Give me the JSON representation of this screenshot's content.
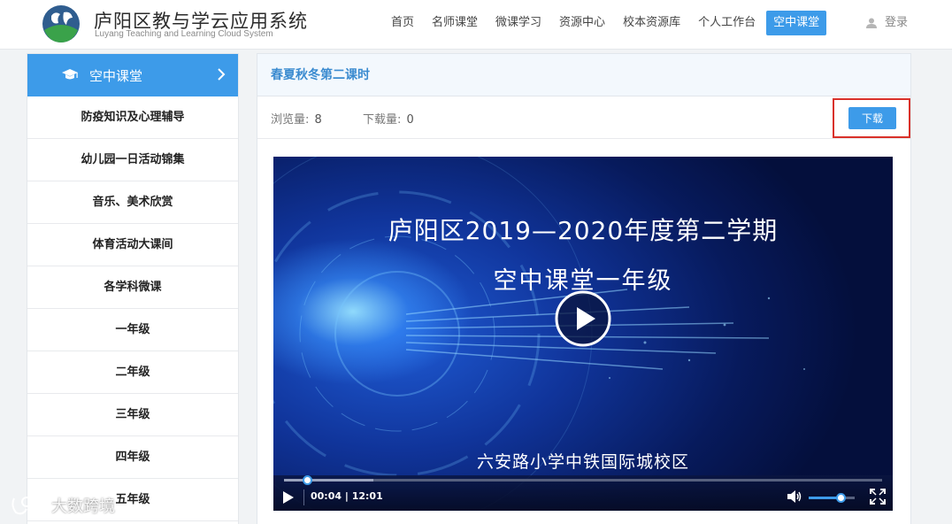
{
  "brand": {
    "title": "庐阳区教与学云应用系统",
    "subtitle": "Luyang Teaching and Learning Cloud System"
  },
  "nav": {
    "items": [
      {
        "label": "首页"
      },
      {
        "label": "名师课堂"
      },
      {
        "label": "微课学习"
      },
      {
        "label": "资源中心"
      },
      {
        "label": "校本资源库"
      },
      {
        "label": "个人工作台"
      },
      {
        "label": "空中课堂",
        "active": true
      }
    ],
    "login_label": "登录"
  },
  "sidebar": {
    "header": "空中课堂",
    "items": [
      {
        "label": "防疫知识及心理辅导"
      },
      {
        "label": "幼儿园一日活动锦集"
      },
      {
        "label": "音乐、美术欣赏"
      },
      {
        "label": "体育活动大课间"
      },
      {
        "label": "各学科微课"
      },
      {
        "label": "一年级"
      },
      {
        "label": "二年级"
      },
      {
        "label": "三年级"
      },
      {
        "label": "四年级"
      },
      {
        "label": "五年级"
      }
    ]
  },
  "content": {
    "title": "春夏秋冬第二课时",
    "views_label": "浏览量:",
    "views_value": "8",
    "downloads_label": "下载量:",
    "downloads_value": "0",
    "download_button": "下载"
  },
  "video": {
    "line1": "庐阳区2019—2020年度第二学期",
    "line2": "空中课堂一年级",
    "line3": "六安路小学中铁国际城校区",
    "current_time": "00:04",
    "duration": "12:01",
    "progress": 0.0055,
    "buffered": 0.15,
    "volume": 0.7
  },
  "watermark": {
    "text": "大数跨境"
  },
  "colors": {
    "accent": "#3d9be9",
    "highlight_border": "#d9312a",
    "title_text": "#3b8bd0"
  }
}
